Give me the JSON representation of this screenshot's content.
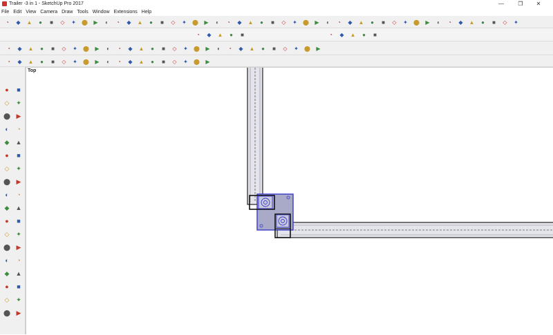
{
  "window": {
    "title": "Trailer -3 in 1 - SketchUp Pro 2017",
    "minimize": "—",
    "maximize": "❐",
    "close": "✕"
  },
  "menu": [
    "File",
    "Edit",
    "View",
    "Camera",
    "Draw",
    "Tools",
    "Window",
    "Extensions",
    "Help"
  ],
  "viewport": {
    "scene_label": "Top"
  },
  "colors": {
    "chrome": "#f0f0f0",
    "icon_red": "#c0392b",
    "icon_blue": "#2e5aa8",
    "icon_gold": "#c89b2a",
    "selection_blue": "#3a3ac8",
    "trailer_fill": "#e8e8f0"
  },
  "toolbars": {
    "row1": [
      "camera-orbit-icon",
      "pan-icon",
      "zoom-icon",
      "zoom-window-icon",
      "zoom-extents-icon",
      "previous-icon",
      "next-icon",
      "position-camera-icon",
      "look-around-icon",
      "walk-icon",
      "section-plane-icon",
      "display-section-icon",
      "section-cuts-icon",
      "x-ray-icon",
      "back-edges-icon",
      "wireframe-icon",
      "hidden-line-icon",
      "shaded-icon",
      "textured-icon",
      "monochrome-icon",
      "shadows-icon",
      "fog-icon",
      "edge-style-icon",
      "profile-icon",
      "depth-cue-icon",
      "extension-icon",
      "iso-view-icon",
      "top-view-icon",
      "front-view-icon",
      "right-view-icon",
      "back-view-icon",
      "left-view-icon",
      "bottom-view-icon",
      "perspective-icon",
      "parallel-icon",
      "two-point-icon",
      "match-photo-icon",
      "sandbox-icon",
      "stamp-icon",
      "drape-icon",
      "smoove-icon",
      "add-detail-icon",
      "flip-edge-icon",
      "get-models-icon",
      "share-model-icon",
      "share-component-icon",
      "extension-warehouse-icon"
    ],
    "row2": [
      "component-iso-icon",
      "component-front-icon",
      "home-icon",
      "house-solid-icon",
      "house-outline-icon",
      "dynamic-component-a-icon",
      "dynamic-component-b-icon",
      "dynamic-component-c-icon",
      "dynamic-component-d-icon",
      "dynamic-component-e-icon"
    ],
    "row3": [
      "tape-icon",
      "eraser-icon",
      "paint-icon",
      "follow-me-icon",
      "push-pull-icon",
      "offset-icon",
      "rotate-icon",
      "scale-icon",
      "move-icon",
      "protractor-icon",
      "text-icon",
      "axes-icon",
      "dimension-icon",
      "intersect-icon",
      "outer-shell-icon",
      "union-icon",
      "subtract-icon",
      "trim-icon",
      "split-icon",
      "solid-tools-icon",
      "layer-icon",
      "style-icon",
      "scene-icon",
      "location-icon",
      "geo-icon",
      "gear-icon",
      "tools-icon",
      "warning-icon",
      "info-icon"
    ],
    "row4": [
      "extension-1-icon",
      "extension-2-icon",
      "extension-3-icon",
      "extension-4-icon",
      "extension-5-icon",
      "extension-6-icon",
      "extension-7-icon",
      "extension-8-icon",
      "extension-9-icon",
      "extension-10-icon",
      "extension-11-icon",
      "extension-12-icon",
      "extension-13-icon",
      "extension-14-icon",
      "extension-15-icon",
      "extension-16-icon",
      "extension-17-icon",
      "extension-18-icon",
      "extension-19-icon"
    ]
  },
  "left_tools": [
    "select-icon",
    "eraser-icon",
    "paint-bucket-icon",
    "eraser-tool-icon",
    "pencil-line-icon",
    "freehand-icon",
    "rectangle-icon",
    "rotated-rectangle-icon",
    "circle-icon",
    "polygon-icon",
    "arc-icon",
    "pie-icon",
    "two-point-arc-icon",
    "three-point-arc-icon",
    "move-icon",
    "push-pull-icon",
    "rotate-icon",
    "follow-me-icon",
    "scale-icon",
    "offset-icon",
    "tape-measure-icon",
    "dimension-icon",
    "protractor-icon",
    "text-icon",
    "axes-icon",
    "3d-text-icon",
    "orbit-icon",
    "pan-icon",
    "zoom-icon",
    "zoom-window-icon",
    "zoom-extents-icon",
    "previous-view-icon",
    "position-camera-icon",
    "look-around-icon",
    "walk-icon",
    "section-plane-icon"
  ]
}
